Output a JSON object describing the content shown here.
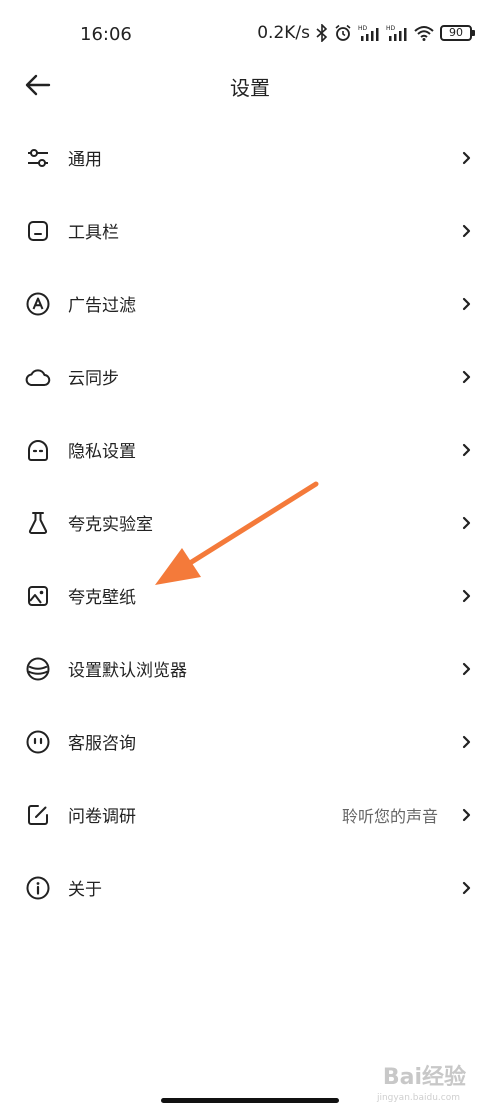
{
  "status_bar": {
    "time": "16:06",
    "net_speed": "0.2K/s",
    "battery": "90",
    "icons": [
      "bluetooth-icon",
      "alarm-icon",
      "signal-hd-icon",
      "signal-hd-icon",
      "wifi-icon",
      "battery-icon"
    ]
  },
  "header": {
    "title": "设置",
    "back_icon": "arrow-left-icon"
  },
  "settings": {
    "items": [
      {
        "label": "通用",
        "icon": "sliders-icon"
      },
      {
        "label": "工具栏",
        "icon": "toolbar-icon"
      },
      {
        "label": "广告过滤",
        "icon": "ad-filter-icon"
      },
      {
        "label": "云同步",
        "icon": "cloud-icon"
      },
      {
        "label": "隐私设置",
        "icon": "privacy-icon"
      },
      {
        "label": "夸克实验室",
        "icon": "flask-icon"
      },
      {
        "label": "夸克壁纸",
        "icon": "wallpaper-icon"
      },
      {
        "label": "设置默认浏览器",
        "icon": "browser-icon"
      },
      {
        "label": "客服咨询",
        "icon": "support-icon"
      },
      {
        "label": "问卷调研",
        "icon": "survey-icon",
        "value": "聆听您的声音"
      },
      {
        "label": "关于",
        "icon": "info-icon"
      }
    ]
  },
  "annotation": {
    "arrow_color": "#F47A3A"
  },
  "watermark": {
    "text": "Bai经验",
    "sub": "jingyan.baidu.com"
  }
}
